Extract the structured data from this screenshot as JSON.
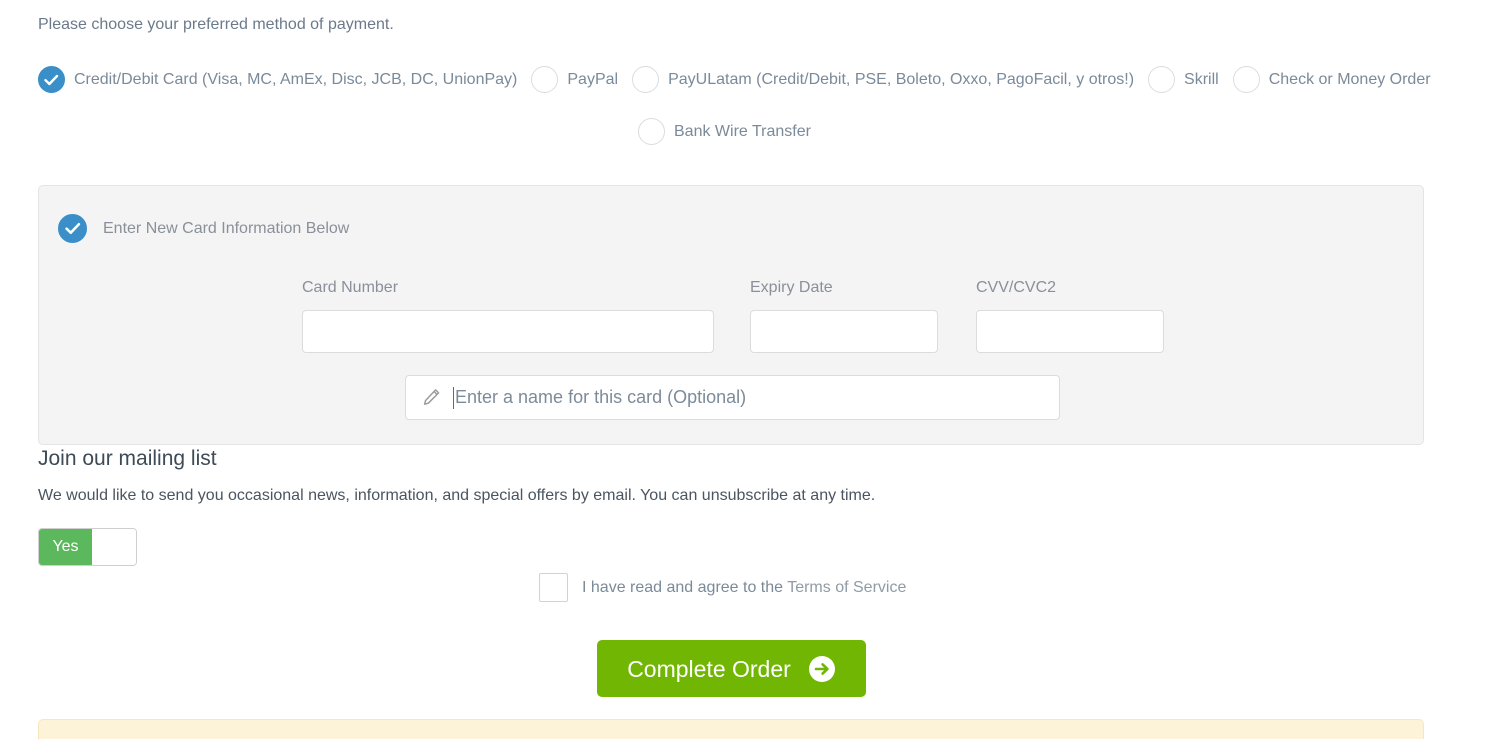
{
  "intro": {
    "text": "Please choose your preferred method of payment."
  },
  "payment_methods": {
    "row1": [
      {
        "label": "Credit/Debit Card (Visa, MC, AmEx, Disc, JCB, DC, UnionPay)",
        "selected": true
      },
      {
        "label": "PayPal",
        "selected": false
      },
      {
        "label": "PayULatam (Credit/Debit, PSE, Boleto, Oxxo, PagoFacil, y otros!)",
        "selected": false
      },
      {
        "label": "Skrill",
        "selected": false
      },
      {
        "label": "Check or Money Order",
        "selected": false
      }
    ],
    "row2": [
      {
        "label": "Bank Wire Transfer",
        "selected": false
      }
    ]
  },
  "card_panel": {
    "header_label": "Enter New Card Information Below",
    "header_selected": true,
    "fields": {
      "card_number": {
        "label": "Card Number",
        "value": "",
        "placeholder": ""
      },
      "expiry_date": {
        "label": "Expiry Date",
        "value": "",
        "placeholder": ""
      },
      "cvv": {
        "label": "CVV/CVC2",
        "value": "",
        "placeholder": ""
      }
    },
    "card_name": {
      "icon": "pencil-icon",
      "value": "",
      "placeholder": "Enter a name for this card (Optional)"
    }
  },
  "mailing_list": {
    "title": "Join our mailing list",
    "description": "We would like to send you occasional news, information, and special offers by email. You can unsubscribe at any time.",
    "toggle": {
      "on_label": "Yes",
      "state": "Yes"
    }
  },
  "terms": {
    "checked": false,
    "label_prefix": "I have read and agree to the ",
    "link_text": "Terms of Service"
  },
  "actions": {
    "complete_order_label": "Complete Order",
    "complete_order_icon": "arrow-right-circle-icon"
  },
  "colors": {
    "accent_blue": "#3a8fc8",
    "toggle_green": "#5cb85c",
    "button_green": "#70b603",
    "panel_bg": "#f4f4f4",
    "notice_bg": "#fdf3d8"
  }
}
